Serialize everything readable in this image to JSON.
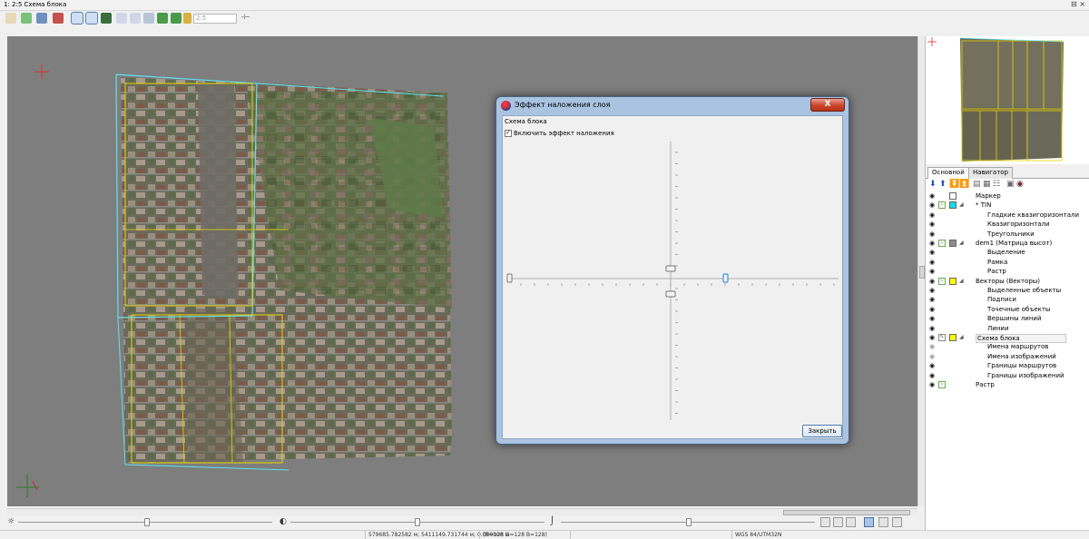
{
  "window": {
    "title": "1: 2:5 Схема блока",
    "controls": "⊟ ×"
  },
  "toolbar": {
    "scale_value": "2:5",
    "buttons": [
      "pan-hand-icon",
      "layers-icon",
      "filter-icon",
      "grid-icon",
      "view-a-icon",
      "view-b-icon",
      "view-c-icon",
      "zoom-in-icon",
      "zoom-out-icon",
      "zoom-extent-icon",
      "zoom-prev-icon",
      "zoom-next-icon",
      "zoom-select-icon"
    ],
    "pin_glyph": "-⊢"
  },
  "dialog": {
    "title": "Эффект наложения слоя",
    "close_glyph": "X",
    "group_label": "Схема блока",
    "checkbox_label": "Включить эффект наложения",
    "checkbox_checked": true,
    "close_button": "Закрыть"
  },
  "right_panel": {
    "tabs": [
      "Основной",
      "Навигатор"
    ],
    "active_tab": 0,
    "layers": [
      {
        "label": "Маркер",
        "level": 0,
        "swatch": "#ffffff",
        "eye": true,
        "chev": false,
        "tri": false
      },
      {
        "label": "* TIN",
        "level": 0,
        "swatch": "#18d8e8",
        "eye": true,
        "chev": true,
        "tri": true
      },
      {
        "label": "Гладкие квазигоризонтали",
        "level": 1,
        "eye": true
      },
      {
        "label": "Квазигоризонтали",
        "level": 1,
        "eye": true
      },
      {
        "label": "Треугольники",
        "level": 1,
        "eye": true
      },
      {
        "label": "dem1 (Матрица высот)",
        "level": 0,
        "swatch": "#8c8c8c",
        "eye": true,
        "chev": true,
        "tri": true
      },
      {
        "label": "Выделение",
        "level": 1,
        "eye": true
      },
      {
        "label": "Рамка",
        "level": 1,
        "eye": true
      },
      {
        "label": "Растр",
        "level": 1,
        "eye": true
      },
      {
        "label": "Векторы (Векторы)",
        "level": 0,
        "swatch": "#ffff00",
        "eye": true,
        "chev": true,
        "tri": true
      },
      {
        "label": "Выделенные объекты",
        "level": 1,
        "eye": true
      },
      {
        "label": "Подписи",
        "level": 1,
        "eye": true
      },
      {
        "label": "Точечные объекты",
        "level": 1,
        "eye": true
      },
      {
        "label": "Вершины линий",
        "level": 1,
        "eye": true
      },
      {
        "label": "Линии",
        "level": 1,
        "eye": true
      },
      {
        "label": "Схема блока",
        "level": 0,
        "swatch": "#ffff00",
        "eye": true,
        "pencil": true,
        "tri": true,
        "selected": true
      },
      {
        "label": "Имена маршрутов",
        "level": 1,
        "eye": false
      },
      {
        "label": "Имена изображений",
        "level": 1,
        "eye": false
      },
      {
        "label": "Границы маршрутов",
        "level": 1,
        "eye": true
      },
      {
        "label": "Границы изображений",
        "level": 1,
        "eye": true
      },
      {
        "label": "Растр",
        "level": 0,
        "eye": true,
        "chev": true,
        "tri": false
      }
    ]
  },
  "bottom": {
    "brightness_icon": "☼",
    "contrast_icon": "◐",
    "gamma_icon": "⌡",
    "view_buttons": 6
  },
  "status": {
    "coords": "579685.782582 м; 5411149.731744 м; 0.000000 м",
    "rgb": "(R=128 G=128 B=128)",
    "crs": "WGS 84/UTM32N"
  },
  "colors": {
    "map_bg": "#7e7e7e",
    "footprint_yellow": "#e8d400",
    "footprint_cyan": "#5fe0f0",
    "accent_red": "#e03030"
  }
}
